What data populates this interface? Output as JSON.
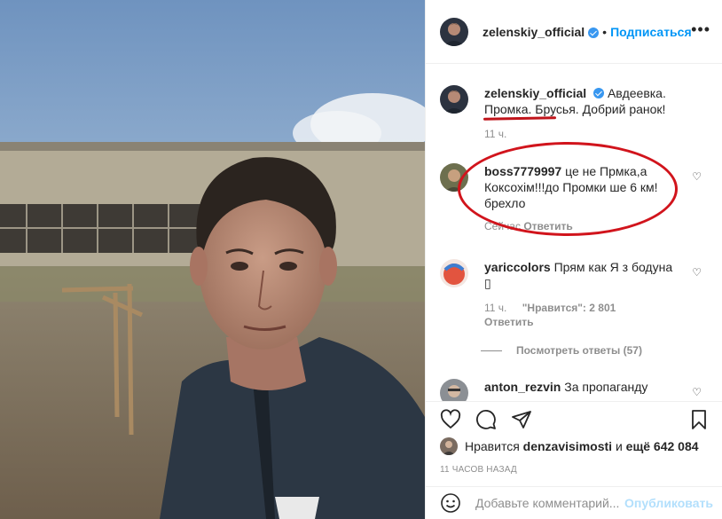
{
  "header": {
    "username": "zelenskiy_official",
    "dot": "•",
    "follow_label": "Подписаться",
    "more_label": "•••"
  },
  "caption": {
    "username": "zelenskiy_official",
    "text_part1": "Авдеевка.",
    "text_part2": "Промка. Брусья. Добрий ранок!",
    "time": "11 ч."
  },
  "comments": [
    {
      "username": "boss7779997",
      "text": "це не Прмка,а Коксохім!!!до Промки ше 6 км! брехло",
      "time": "Сейчас",
      "reply_label": "Ответить"
    },
    {
      "username": "yariccolors",
      "text": "Прям как Я з бодуна",
      "emoji": "▯",
      "time": "11 ч.",
      "likes": "\"Нравится\": 2 801",
      "reply_label": "Ответить",
      "view_replies": "Посмотреть ответы (57)"
    },
    {
      "username": "anton_rezvin",
      "text": "За пропаганду"
    }
  ],
  "likes": {
    "prefix": "Нравится",
    "user": "denzavisimosti",
    "and": "и",
    "others": "ещё 642 084"
  },
  "time_ago": "11 ЧАСОВ НАЗАД",
  "add_comment": {
    "placeholder": "Добавьте комментарий...",
    "publish_label": "Опубликовать"
  },
  "colors": {
    "accent": "#0095f6",
    "annotation_red": "#d1141c",
    "muted": "#8e8e8e"
  },
  "icons": [
    "heart-icon",
    "comment-icon",
    "share-icon",
    "bookmark-icon",
    "smile-icon",
    "verified-icon"
  ]
}
